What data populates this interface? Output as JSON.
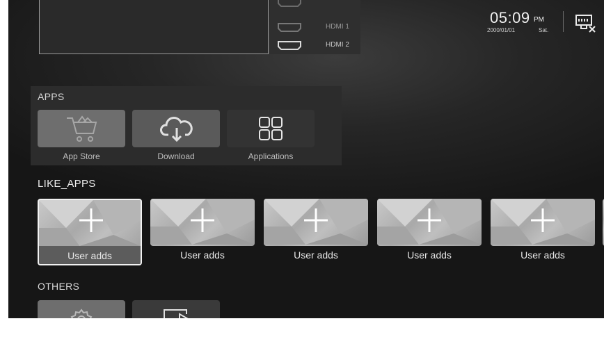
{
  "inputs": {
    "items": [
      {
        "label": "HDMI 1"
      },
      {
        "label": "HDMI 2"
      }
    ]
  },
  "status": {
    "time": "05:09",
    "ampm": "PM",
    "date": "2000/01/01",
    "day": "Sat.",
    "network_icon": "ethernet-disconnected-icon"
  },
  "apps": {
    "title": "APPS",
    "items": [
      {
        "label": "App Store",
        "icon": "cart-icon"
      },
      {
        "label": "Download",
        "icon": "cloud-download-icon"
      },
      {
        "label": "Applications",
        "icon": "grid-icon"
      }
    ]
  },
  "like_apps": {
    "title": "LIKE_APPS",
    "items": [
      {
        "label": "User adds"
      },
      {
        "label": "User adds"
      },
      {
        "label": "User adds"
      },
      {
        "label": "User adds"
      },
      {
        "label": "User adds"
      }
    ]
  },
  "others": {
    "title": "OTHERS",
    "items": [
      {
        "icon": "gear-icon"
      },
      {
        "icon": "screen-cast-icon"
      }
    ]
  },
  "colors": {
    "background": "#1e1e1e",
    "tile_active": "#6a6a6a",
    "tile_dark": "#3a3a3a",
    "text": "#d8d8d8"
  }
}
